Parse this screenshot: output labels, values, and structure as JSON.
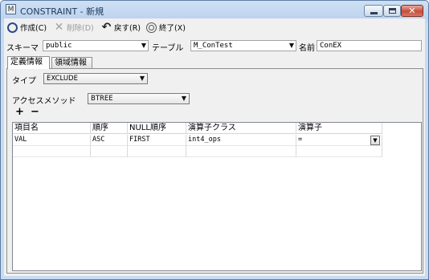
{
  "window": {
    "title": "CONSTRAINT - 新規",
    "app_icon": "M"
  },
  "toolbar": {
    "create_label": "作成(C)",
    "delete_label": "削除(D)",
    "back_label": "戻す(R)",
    "end_label": "終了(X)"
  },
  "schema": {
    "schema_label": "スキーマ",
    "schema_value": "public",
    "table_label": "テーブル",
    "table_value": "M_ConTest",
    "name_label": "名前",
    "name_value": "ConEX"
  },
  "tabs": [
    {
      "label": "定義情報",
      "selected": true
    },
    {
      "label": "領域情報",
      "selected": false
    }
  ],
  "definition": {
    "type_label": "タイプ",
    "type_value": "EXCLUDE",
    "access_label": "アクセスメソッド",
    "access_value": "BTREE",
    "add_symbol": "+",
    "remove_symbol": "−"
  },
  "grid": {
    "columns": [
      "項目名",
      "順序",
      "NULL順序",
      "演算子クラス",
      "演算子"
    ],
    "rows": [
      [
        "VAL",
        "ASC",
        "FIRST",
        "int4_ops",
        "="
      ]
    ]
  },
  "icons": {
    "create": "circle-icon",
    "delete": "x-icon",
    "back": "undo-icon",
    "end": "stop-icon"
  }
}
